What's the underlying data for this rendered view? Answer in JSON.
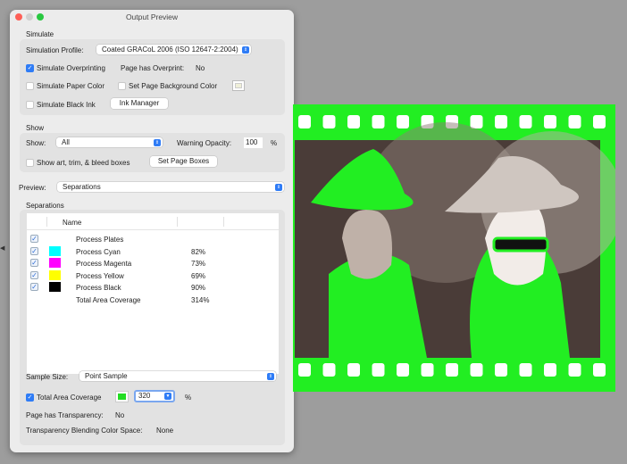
{
  "window": {
    "title": "Output Preview"
  },
  "simulate": {
    "heading": "Simulate",
    "profile_label": "Simulation Profile:",
    "profile_value": "Coated GRACoL 2006 (ISO 12647-2:2004)",
    "overprint_label": "Simulate Overprinting",
    "overprint_checked": true,
    "page_overprint_label": "Page has Overprint:",
    "page_overprint_value": "No",
    "paper_color_label": "Simulate Paper Color",
    "bg_color_label": "Set Page Background Color",
    "black_ink_label": "Simulate Black Ink",
    "ink_manager": "Ink Manager"
  },
  "show": {
    "heading": "Show",
    "show_label": "Show:",
    "show_value": "All",
    "opacity_label": "Warning Opacity:",
    "opacity_value": "100",
    "opacity_unit": "%",
    "boxes_label": "Show art, trim, & bleed boxes",
    "set_boxes": "Set Page Boxes"
  },
  "preview": {
    "label": "Preview:",
    "value": "Separations"
  },
  "separations": {
    "heading": "Separations",
    "col_name": "Name",
    "rows": [
      {
        "name": "Process Plates",
        "value": "",
        "color": ""
      },
      {
        "name": "Process Cyan",
        "value": "82%",
        "color": "#00ffff"
      },
      {
        "name": "Process Magenta",
        "value": "73%",
        "color": "#ff00ff"
      },
      {
        "name": "Process Yellow",
        "value": "69%",
        "color": "#ffff00"
      },
      {
        "name": "Process Black",
        "value": "90%",
        "color": "#000000"
      },
      {
        "name": "Total Area Coverage",
        "value": "314%",
        "color": ""
      }
    ]
  },
  "sample": {
    "label": "Sample Size:",
    "value": "Point Sample"
  },
  "tac": {
    "label": "Total Area Coverage",
    "value": "320",
    "unit": "%",
    "color": "#22dd22"
  },
  "transparency": {
    "label": "Page has Transparency:",
    "value": "No",
    "blend_label": "Transparency Blending Color Space:",
    "blend_value": "None"
  }
}
